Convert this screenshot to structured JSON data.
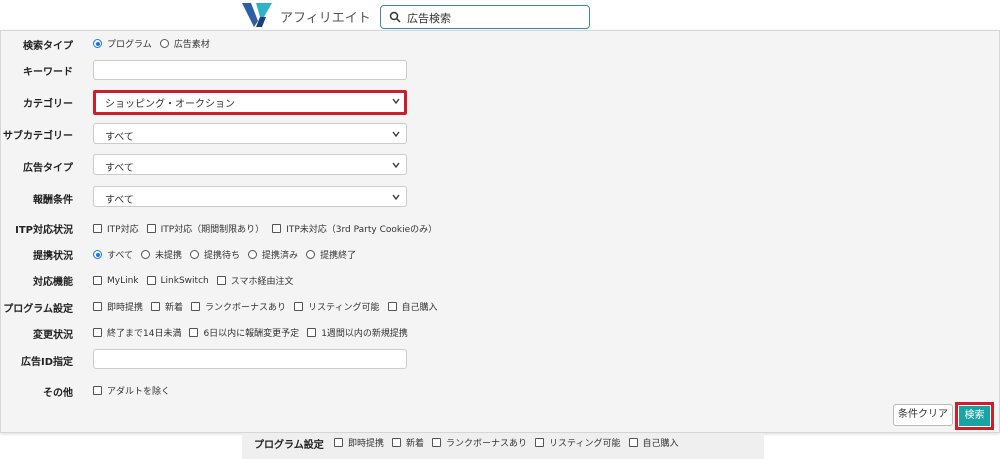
{
  "header": {
    "app_name": "アフィリエイト",
    "search_placeholder": "広告検索",
    "logo_color": "#2b5fa8"
  },
  "form": {
    "search_type": {
      "label": "検索タイプ",
      "options": [
        "プログラム",
        "広告素材"
      ],
      "selected": "プログラム"
    },
    "keyword": {
      "label": "キーワード",
      "value": ""
    },
    "category": {
      "label": "カテゴリー",
      "value": "ショッピング・オークション"
    },
    "subcategory": {
      "label": "サブカテゴリー",
      "value": "すべて"
    },
    "ad_type": {
      "label": "広告タイプ",
      "value": "すべて"
    },
    "reward": {
      "label": "報酬条件",
      "value": "すべて"
    },
    "itp": {
      "label": "ITP対応状況",
      "options": [
        "ITP対応",
        "ITP対応（期間制限あり）",
        "ITP未対応（3rd Party Cookieのみ）"
      ]
    },
    "affiliation": {
      "label": "提携状況",
      "options": [
        "すべて",
        "未提携",
        "提携待ち",
        "提携済み",
        "提携終了"
      ],
      "selected": "すべて"
    },
    "features": {
      "label": "対応機能",
      "options": [
        "MyLink",
        "LinkSwitch",
        "スマホ経由注文"
      ]
    },
    "program_settings": {
      "label": "プログラム設定",
      "options": [
        "即時提携",
        "新着",
        "ランクボーナスあり",
        "リスティング可能",
        "自己購入"
      ]
    },
    "change_status": {
      "label": "変更状況",
      "options": [
        "終了まで14日未満",
        "6日以内に報酬変更予定",
        "1週間以内の新規提携"
      ]
    },
    "ad_id": {
      "label": "広告ID指定",
      "value": ""
    },
    "other": {
      "label": "その他",
      "options": [
        "アダルトを除く"
      ]
    }
  },
  "buttons": {
    "clear": "条件クリア",
    "search": "検索"
  },
  "lower": {
    "label": "プログラム設定",
    "options": [
      "即時提携",
      "新着",
      "ランクボーナスあり",
      "リスティング可能",
      "自己購入"
    ]
  },
  "colors": {
    "accent": "#1aa3a3",
    "highlight": "#cc1f2a",
    "radio": "#1a73e8"
  }
}
